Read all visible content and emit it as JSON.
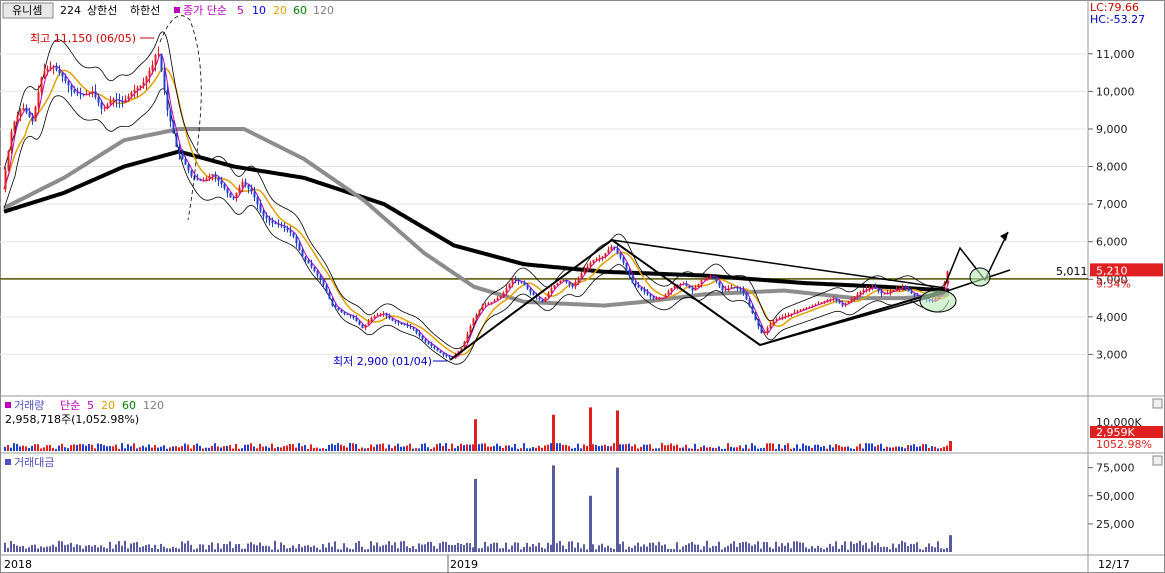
{
  "header": {
    "stock_name": "유니셈",
    "period": "224",
    "upper_limit_label": "상한선",
    "lower_limit_label": "하한선",
    "ma_legend": {
      "label": "종가 단순",
      "periods": [
        "5",
        "10",
        "20",
        "60",
        "120"
      ],
      "colors": [
        "#c000c0",
        "#0000ff",
        "#e0a000",
        "#008000",
        "#808080"
      ]
    },
    "lc_label": "LC:79.66",
    "hc_label": "HC:-53.27"
  },
  "annotations": {
    "high_label": "최고 11,150 (06/05)",
    "low_label": "최저 2,900 (01/04)",
    "ref_line_value": "5,011",
    "current_price": "5,210",
    "change_pct": "9.34%"
  },
  "volume_panel": {
    "legend_label": "거래량",
    "ma_label": "단순",
    "ma_periods": [
      "5",
      "20",
      "60",
      "120"
    ],
    "current_volume_text": "2,958,718주(1,052.98%)",
    "badge_volume": "2,959K",
    "badge_pct": "1052.98%",
    "axis_label": "10,000K"
  },
  "amount_panel": {
    "legend_label": "거래대금",
    "axis_labels": [
      "75,000",
      "50,000",
      "25,000"
    ]
  },
  "x_axis": {
    "labels": [
      "2018",
      "2019"
    ],
    "right_date": "12/17"
  },
  "chart_data": {
    "type": "candlestick",
    "y_ticks": [
      3000,
      4000,
      5000,
      6000,
      7000,
      8000,
      9000,
      10000,
      11000
    ],
    "y_tick_labels": [
      "3,000",
      "4,000",
      "5,000",
      "6,000",
      "7,000",
      "8,000",
      "9,000",
      "10,000",
      "11,000"
    ],
    "ylim": [
      2000,
      11900
    ],
    "reference_level": 5011,
    "price_path": [
      [
        0,
        7400
      ],
      [
        10,
        9100
      ],
      [
        20,
        9600
      ],
      [
        30,
        9200
      ],
      [
        40,
        10500
      ],
      [
        50,
        10700
      ],
      [
        60,
        10400
      ],
      [
        70,
        10000
      ],
      [
        80,
        9900
      ],
      [
        90,
        10000
      ],
      [
        100,
        9500
      ],
      [
        110,
        9800
      ],
      [
        120,
        9700
      ],
      [
        130,
        10000
      ],
      [
        140,
        10200
      ],
      [
        150,
        10700
      ],
      [
        155,
        11150
      ],
      [
        160,
        10400
      ],
      [
        165,
        9500
      ],
      [
        170,
        9000
      ],
      [
        175,
        8400
      ],
      [
        180,
        8200
      ],
      [
        190,
        7700
      ],
      [
        200,
        7600
      ],
      [
        210,
        7800
      ],
      [
        220,
        7500
      ],
      [
        230,
        7100
      ],
      [
        240,
        7600
      ],
      [
        250,
        7300
      ],
      [
        260,
        6700
      ],
      [
        270,
        6500
      ],
      [
        280,
        6400
      ],
      [
        290,
        6200
      ],
      [
        300,
        5600
      ],
      [
        310,
        5300
      ],
      [
        320,
        4900
      ],
      [
        330,
        4300
      ],
      [
        340,
        4100
      ],
      [
        350,
        4000
      ],
      [
        360,
        3700
      ],
      [
        370,
        4000
      ],
      [
        380,
        4100
      ],
      [
        390,
        3900
      ],
      [
        400,
        3800
      ],
      [
        410,
        3700
      ],
      [
        420,
        3400
      ],
      [
        430,
        3200
      ],
      [
        440,
        3000
      ],
      [
        450,
        2900
      ],
      [
        460,
        3200
      ],
      [
        470,
        3900
      ],
      [
        480,
        4300
      ],
      [
        490,
        4400
      ],
      [
        500,
        4600
      ],
      [
        510,
        5000
      ],
      [
        520,
        4900
      ],
      [
        530,
        4600
      ],
      [
        540,
        4400
      ],
      [
        550,
        4800
      ],
      [
        560,
        5000
      ],
      [
        570,
        4800
      ],
      [
        580,
        5200
      ],
      [
        590,
        5500
      ],
      [
        600,
        5600
      ],
      [
        610,
        5900
      ],
      [
        615,
        5700
      ],
      [
        620,
        5500
      ],
      [
        630,
        4900
      ],
      [
        640,
        4700
      ],
      [
        650,
        4500
      ],
      [
        660,
        4500
      ],
      [
        670,
        4800
      ],
      [
        680,
        4900
      ],
      [
        690,
        4700
      ],
      [
        700,
        5000
      ],
      [
        710,
        5100
      ],
      [
        720,
        4700
      ],
      [
        730,
        4800
      ],
      [
        740,
        4700
      ],
      [
        750,
        4100
      ],
      [
        760,
        3500
      ],
      [
        770,
        3900
      ],
      [
        780,
        4000
      ],
      [
        790,
        4100
      ],
      [
        800,
        4200
      ],
      [
        810,
        4300
      ],
      [
        820,
        4400
      ],
      [
        830,
        4500
      ],
      [
        840,
        4300
      ],
      [
        850,
        4500
      ],
      [
        860,
        4700
      ],
      [
        870,
        4800
      ],
      [
        880,
        4600
      ],
      [
        890,
        4700
      ],
      [
        900,
        4800
      ],
      [
        910,
        4600
      ],
      [
        920,
        4500
      ],
      [
        930,
        4400
      ],
      [
        940,
        4700
      ],
      [
        945,
        5210
      ]
    ],
    "ma120_path": [
      [
        0,
        6800
      ],
      [
        60,
        7300
      ],
      [
        120,
        8000
      ],
      [
        175,
        8400
      ],
      [
        230,
        8000
      ],
      [
        300,
        7700
      ],
      [
        380,
        7000
      ],
      [
        450,
        5900
      ],
      [
        520,
        5400
      ],
      [
        600,
        5200
      ],
      [
        700,
        5100
      ],
      [
        800,
        4900
      ],
      [
        880,
        4800
      ],
      [
        945,
        4700
      ]
    ],
    "ma60_path": [
      [
        0,
        6900
      ],
      [
        60,
        7700
      ],
      [
        120,
        8700
      ],
      [
        175,
        9000
      ],
      [
        240,
        9000
      ],
      [
        300,
        8200
      ],
      [
        360,
        7100
      ],
      [
        420,
        5700
      ],
      [
        470,
        4800
      ],
      [
        520,
        4400
      ],
      [
        600,
        4300
      ],
      [
        640,
        4400
      ],
      [
        700,
        4600
      ],
      [
        780,
        4700
      ],
      [
        850,
        4500
      ],
      [
        900,
        4500
      ],
      [
        945,
        4600
      ]
    ],
    "annotation_high": {
      "value": 11150,
      "date": "06/05"
    },
    "annotation_low": {
      "value": 2900,
      "date": "01/04"
    },
    "volume_spikes": [
      470,
      548,
      585,
      612,
      945
    ],
    "amount_spikes": [
      [
        470,
        65000
      ],
      [
        548,
        77000
      ],
      [
        585,
        50000
      ],
      [
        612,
        75000
      ],
      [
        945,
        15000
      ]
    ],
    "amount_axis": [
      25000,
      50000,
      75000
    ]
  }
}
